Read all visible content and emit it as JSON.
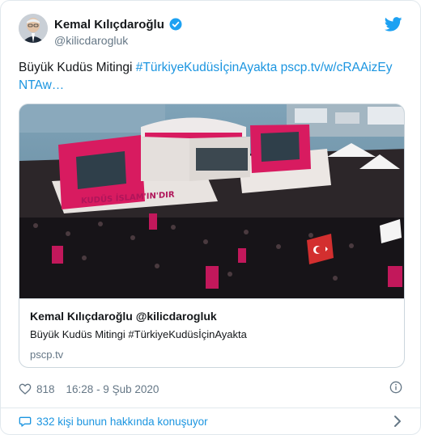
{
  "author": {
    "name": "Kemal Kılıçdaroğlu",
    "handle": "@kilicdarogluk"
  },
  "icons": {
    "verified": "verified-badge-icon",
    "platform": "twitter-bird-icon",
    "like": "heart-icon",
    "info": "info-icon",
    "reply": "speech-bubble-icon",
    "more": "chevron-right-icon"
  },
  "tweet": {
    "text_plain": "Büyük Kudüs Mitingi ",
    "hashtag": "#TürkiyeKudüsİçinAyakta",
    "link_text": " pscp.tv/w/cRAAizEyNTAw…"
  },
  "embed": {
    "title": "Kemal Kılıçdaroğlu @kilicdarogluk",
    "description": "Büyük Kudüs Mitingi #TürkiyeKudüsİçinAyakta",
    "domain": "pscp.tv",
    "image_stage_banner": "KUDÜS İSLAM'IN'DIR"
  },
  "footer": {
    "likes": "818",
    "timestamp": "16:28 - 9 Şub 2020"
  },
  "conversation": {
    "label": "332 kişi bunun hakkında konuşuyor"
  },
  "colors": {
    "accent": "#1b95e0",
    "text": "#14171a",
    "muted": "#657786",
    "border": "#e1e8ed",
    "stage_pink": "#d81b60"
  }
}
